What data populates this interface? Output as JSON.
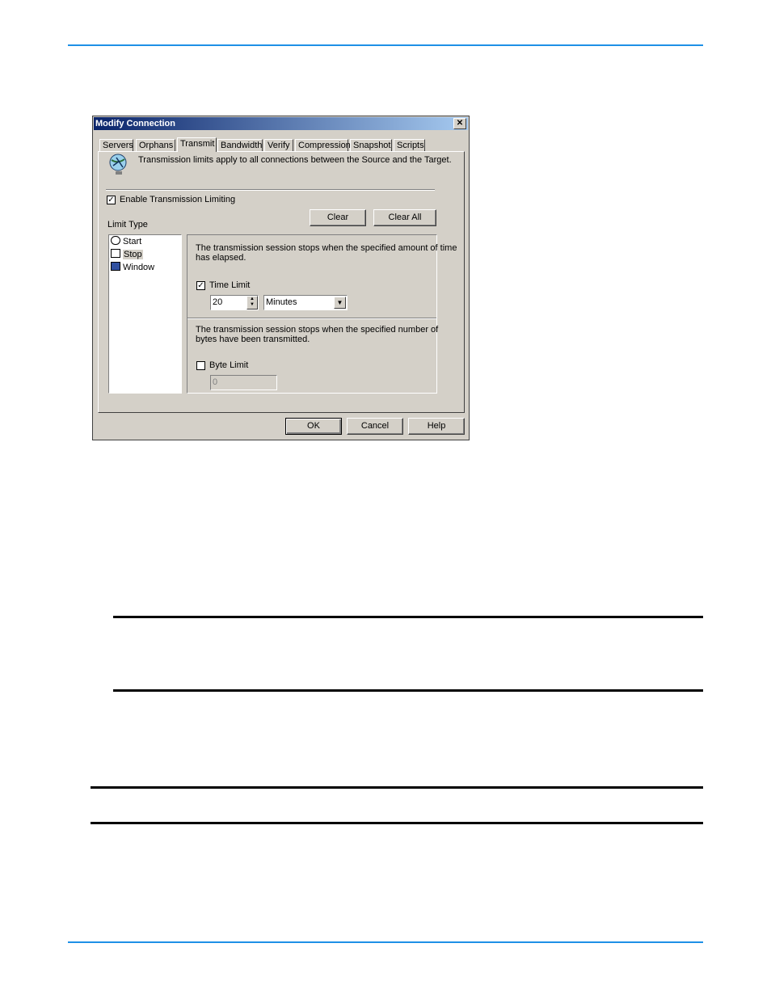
{
  "dialog": {
    "title": "Modify Connection",
    "close_glyph": "✕",
    "tabs": [
      "Servers",
      "Orphans",
      "Transmit",
      "Bandwidth",
      "Verify",
      "Compression",
      "Snapshot",
      "Scripts"
    ],
    "active_tab": "Transmit",
    "info_text": "Transmission limits apply to all connections between the Source and the Target.",
    "enable_limiting": {
      "label": "Enable Transmission Limiting",
      "checked": true
    },
    "clear_label": "Clear",
    "clear_all_label": "Clear All",
    "limit_type_label": "Limit Type",
    "limit_types": [
      {
        "label": "Start",
        "icon": "clock-icon"
      },
      {
        "label": "Stop",
        "icon": "chart-icon",
        "selected": true
      },
      {
        "label": "Window",
        "icon": "window-icon"
      }
    ],
    "time_section": {
      "description_line1": "The transmission session stops when the specified amount of time",
      "description_line2": "has elapsed.",
      "checkbox_label": "Time Limit",
      "checked": true,
      "value": "20",
      "unit": "Minutes"
    },
    "byte_section": {
      "description_line1": "The transmission session stops when the specified number of",
      "description_line2": "bytes have been transmitted.",
      "checkbox_label": "Byte Limit",
      "checked": false,
      "value": "0"
    },
    "ok_label": "OK",
    "cancel_label": "Cancel",
    "help_label": "Help"
  },
  "colors": {
    "page_rule": "#1e90e6",
    "dialog_face": "#d4d0c8",
    "titlebar_start": "#0a246a",
    "titlebar_end": "#a6caf0"
  }
}
